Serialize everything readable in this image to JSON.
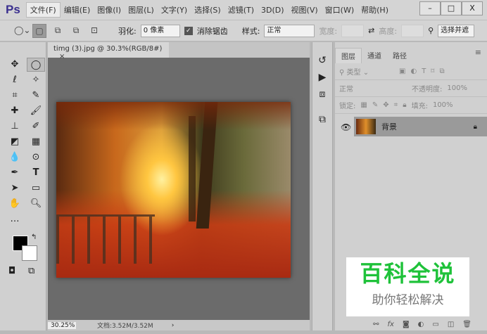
{
  "app": {
    "logo": "Ps"
  },
  "menu": [
    "文件(F)",
    "编辑(E)",
    "图像(I)",
    "图层(L)",
    "文字(Y)",
    "选择(S)",
    "滤镜(T)",
    "3D(D)",
    "视图(V)",
    "窗口(W)",
    "帮助(H)"
  ],
  "window_controls": [
    "–",
    "□",
    "X"
  ],
  "options": {
    "feather_label": "羽化:",
    "feather_value": "0 像素",
    "antialias_label": "消除锯齿",
    "style_label": "样式:",
    "style_value": "正常",
    "width_label": "宽度:",
    "height_label": "高度:",
    "select_mask": "选择并遮"
  },
  "document": {
    "tab_title": "timg (3).jpg @ 30.3%(RGB/8#)",
    "close": "×",
    "zoom": "30.25%",
    "doc_size": "文档:3.52M/3.52M",
    "arrow": "›"
  },
  "layers_panel": {
    "tabs": [
      "图层",
      "通道",
      "路径"
    ],
    "filter_kind": "类型",
    "blend_mode": "正常",
    "opacity_label": "不透明度:",
    "opacity": "100%",
    "lock_label": "锁定:",
    "fill_label": "填充:",
    "fill": "100%",
    "layer_name": "背景"
  },
  "watermark": {
    "title": "百科全说",
    "subtitle": "助你轻松解决"
  },
  "colors": {
    "accent": "#3a2f8f",
    "watermark": "#1fc23a"
  }
}
